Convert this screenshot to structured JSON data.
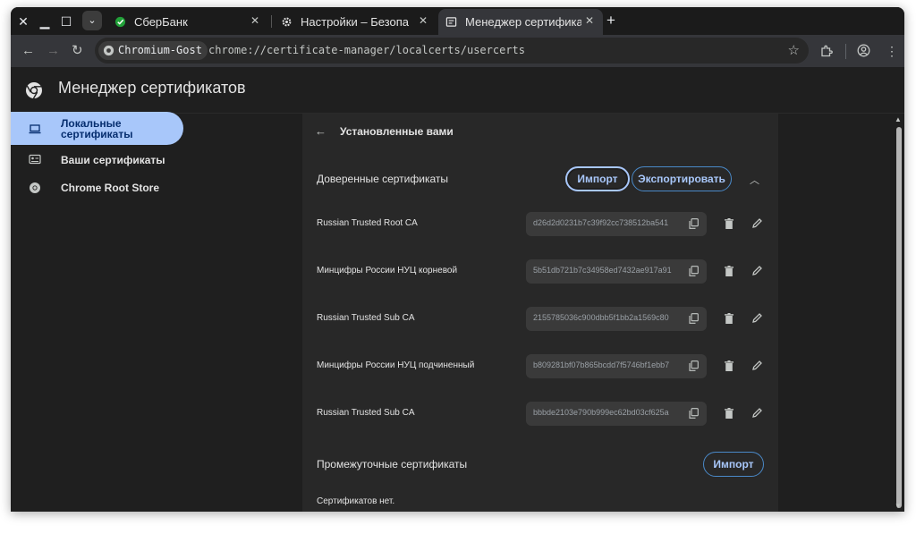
{
  "window_controls": {
    "close": "✕",
    "minimize": "▁",
    "maximize": "☐"
  },
  "tabs": [
    {
      "title": "СберБанк",
      "icon": "sber-icon"
    },
    {
      "title": "Настройки – Безопа",
      "icon": "gear-icon"
    },
    {
      "title": "Менеджер сертифика",
      "icon": "cert-page-icon",
      "active": true
    }
  ],
  "toolbar": {
    "chip_label": "Chromium-Gost",
    "url": "chrome://certificate-manager/localcerts/usercerts"
  },
  "page": {
    "title": "Менеджер сертификатов"
  },
  "sidebar": {
    "items": [
      {
        "label_line1": "Локальные",
        "label_line2": "сертификаты",
        "icon": "laptop-icon",
        "active": true
      },
      {
        "label": "Ваши сертификаты",
        "icon": "id-card-icon"
      },
      {
        "label": "Chrome Root Store",
        "icon": "chrome-icon"
      }
    ]
  },
  "main": {
    "section_title": "Установленные вами",
    "trusted": {
      "title": "Доверенные сертификаты",
      "import_label": "Импорт",
      "export_label": "Экспортировать",
      "rows": [
        {
          "name": "Russian Trusted Root CA",
          "hash": "d26d2d0231b7c39f92cc738512ba541"
        },
        {
          "name": "Минцифры России НУЦ корневой",
          "hash": "5b51db721b7c34958ed7432ae917a91"
        },
        {
          "name": "Russian Trusted Sub CA",
          "hash": "2155785036c900dbb5f1bb2a1569c80"
        },
        {
          "name": "Минцифры России НУЦ подчиненный",
          "hash": "b809281bf07b865bcdd7f5746bf1ebb7"
        },
        {
          "name": "Russian Trusted Sub CA",
          "hash": "bbbde2103e790b999ec62bd03cf625a"
        }
      ]
    },
    "intermediate": {
      "title": "Промежуточные сертификаты",
      "import_label": "Импорт",
      "empty_text": "Сертификатов нет."
    }
  },
  "colors": {
    "accent": "#a8c7fa",
    "background": "#1f1f1f",
    "card": "#282828"
  }
}
